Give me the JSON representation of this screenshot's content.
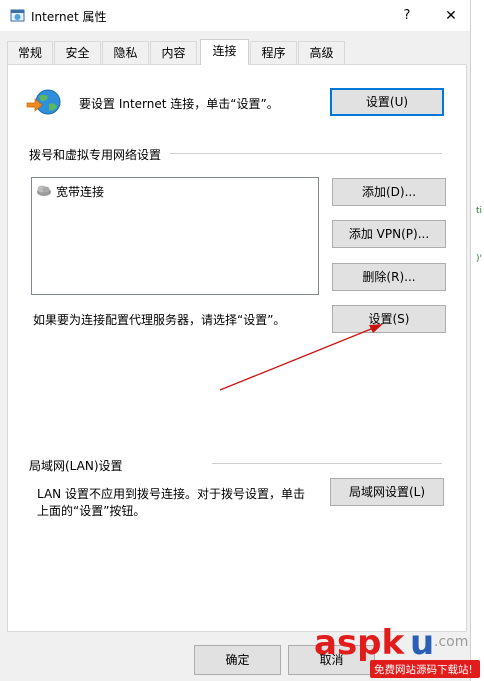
{
  "window": {
    "title": "Internet 属性",
    "help_label": "?",
    "close_label": "✕"
  },
  "tabs": [
    "常规",
    "安全",
    "隐私",
    "内容",
    "连接",
    "程序",
    "高级"
  ],
  "setup": {
    "description": "要设置 Internet 连接，单击“设置”。",
    "button": "设置(U)"
  },
  "dialup": {
    "heading": "拨号和虚拟专用网络设置",
    "connections": [
      "宽带连接"
    ],
    "add_button": "添加(D)...",
    "add_vpn_button": "添加 VPN(P)...",
    "delete_button": "删除(R)...",
    "proxy_text": "如果要为连接配置代理服务器，请选择“设置”。",
    "settings_button": "设置(S)"
  },
  "lan": {
    "heading": "局域网(LAN)设置",
    "text_line1": "LAN 设置不应用到拨号连接。对于拨号设置，单击",
    "text_line2": "上面的“设置”按钮。",
    "button": "局域网设置(L)"
  },
  "footer": {
    "ok_button": "确定",
    "cancel_button": "取消"
  },
  "watermark": {
    "main_aspk": "aspk",
    "main_u": "u",
    "main_suffix": ".com",
    "sub": "免费网站源码下载站!"
  },
  "colors": {
    "accent": "#0078d7",
    "arrow": "#cc1111",
    "watermark_red": "#e21b1b",
    "watermark_blue": "#2a5fb5"
  }
}
